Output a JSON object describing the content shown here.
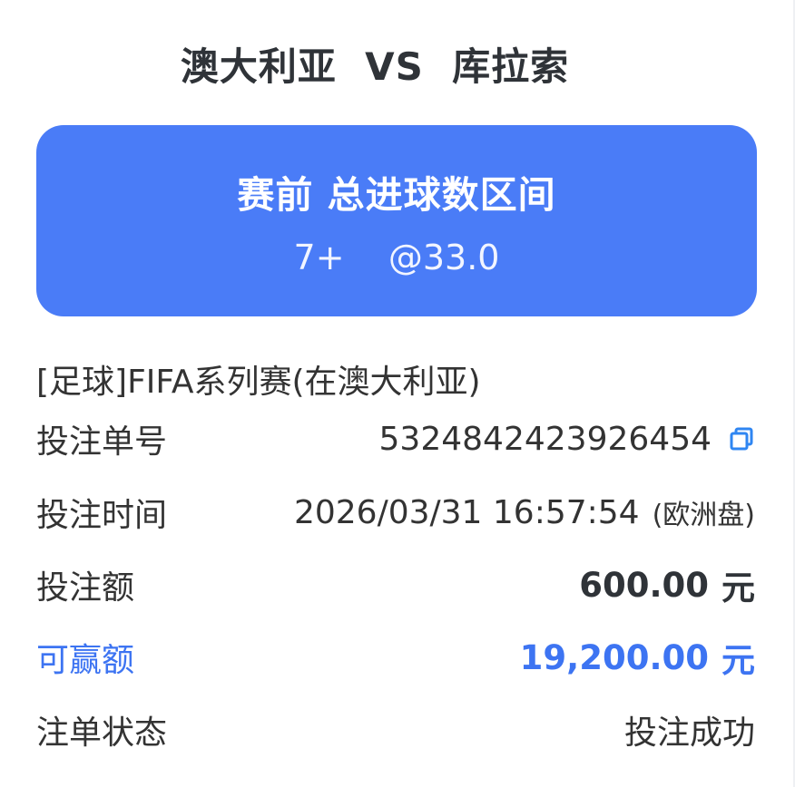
{
  "match": {
    "home": "澳大利亚",
    "vs": "VS",
    "away": "库拉索"
  },
  "bet": {
    "type": "赛前 总进球数区间",
    "selection": "7+",
    "odds": "@33.0"
  },
  "competition": "[足球]FIFA系列赛(在澳大利亚)",
  "details": {
    "order_no_label": "投注单号",
    "order_no": "5324842423926454",
    "time_label": "投注时间",
    "time": "2026/03/31 16:57:54",
    "market_note": "(欧洲盘)",
    "stake_label": "投注额",
    "stake": "600.00",
    "stake_unit": "元",
    "win_label": "可赢额",
    "win": "19,200.00",
    "win_unit": "元",
    "status_label": "注单状态",
    "status": "投注成功"
  },
  "icons": {
    "copy": "copy-icon"
  },
  "colors": {
    "card": "#4a7cf7",
    "accent": "#3d74f2",
    "text": "#333333"
  }
}
